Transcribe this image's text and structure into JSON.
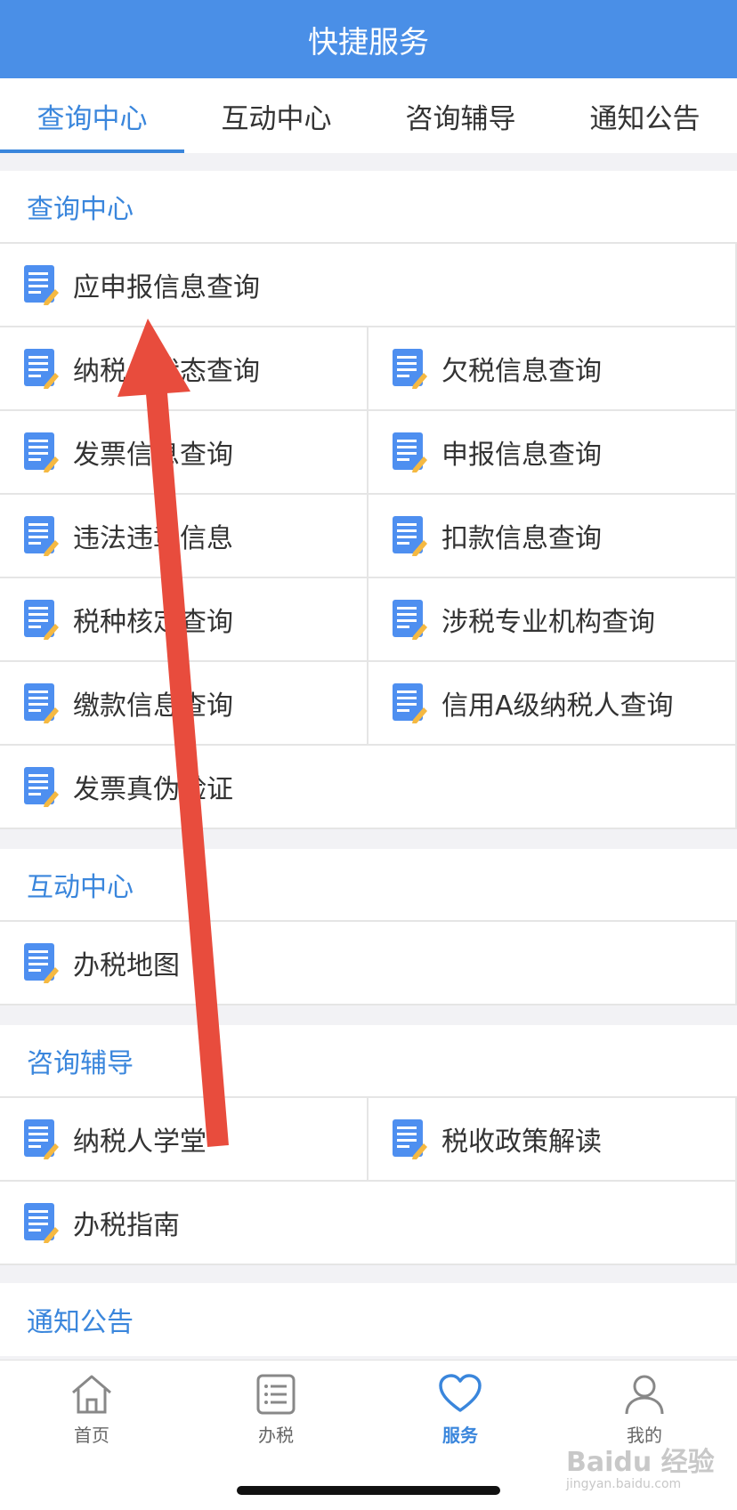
{
  "header": {
    "title": "快捷服务"
  },
  "tabs": [
    "查询中心",
    "互动中心",
    "咨询辅导",
    "通知公告"
  ],
  "sections": {
    "query": {
      "title": "查询中心",
      "items": [
        "应申报信息查询",
        "纳税人状态查询",
        "欠税信息查询",
        "发票信息查询",
        "申报信息查询",
        "违法违章信息",
        "扣款信息查询",
        "税种核定查询",
        "涉税专业机构查询",
        "缴款信息查询",
        "信用A级纳税人查询",
        "发票真伪验证"
      ]
    },
    "interact": {
      "title": "互动中心",
      "items": [
        "办税地图"
      ]
    },
    "consult": {
      "title": "咨询辅导",
      "items": [
        "纳税人学堂",
        "税收政策解读",
        "办税指南"
      ]
    },
    "notice": {
      "title": "通知公告"
    }
  },
  "bottom_nav": [
    {
      "label": "首页",
      "icon": "home-icon"
    },
    {
      "label": "办税",
      "icon": "list-icon"
    },
    {
      "label": "服务",
      "icon": "heart-icon"
    },
    {
      "label": "我的",
      "icon": "user-icon"
    }
  ],
  "watermark": {
    "brand": "Baidu 经验",
    "url": "jingyan.baidu.com"
  },
  "colors": {
    "header": "#4a8fe7",
    "accent": "#3a86dc",
    "arrow": "#e84c3d"
  }
}
